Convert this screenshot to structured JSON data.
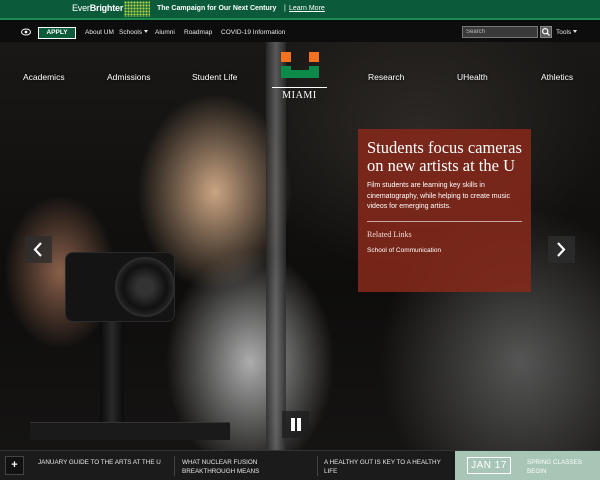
{
  "campaign": {
    "logo_part1": "Ever",
    "logo_part2": "Brighter",
    "text": "The Campaign for Our Next Century",
    "separator": "|",
    "link": "Learn More"
  },
  "utility": {
    "apply": "APPLY",
    "links": [
      "About UM",
      "Schools",
      "Alumni",
      "Roadmap",
      "COVID-19 Information"
    ],
    "search_placeholder": "Search",
    "tools": "Tools"
  },
  "nav": {
    "left": [
      "Academics",
      "Admissions",
      "Student Life"
    ],
    "right": [
      "Research",
      "UHealth",
      "Athletics"
    ],
    "logo_text": "MIAMI"
  },
  "story": {
    "title": "Students focus cameras on new artists at the U",
    "body": "Film students are learning key skills in cinematography, while helping to create music videos for emerging artists.",
    "related_label": "Related Links",
    "related_link": "School of Communication"
  },
  "news": {
    "items": [
      "January Guide to the Arts at the U",
      "What nuclear fusion breakthrough means",
      "A healthy gut is key to a healthy life"
    ]
  },
  "event": {
    "date": "JAN 17",
    "title": "Spring classes begin"
  },
  "colors": {
    "brand_green": "#0b5b3a",
    "brand_orange": "#f47321",
    "story_bg": "#84281a",
    "event_bg": "#a8c6b6"
  },
  "icons": [
    "eye-icon",
    "search-icon",
    "caret-down-icon",
    "chevron-left-icon",
    "chevron-right-icon",
    "pause-icon",
    "plus-icon",
    "um-u-logo"
  ]
}
